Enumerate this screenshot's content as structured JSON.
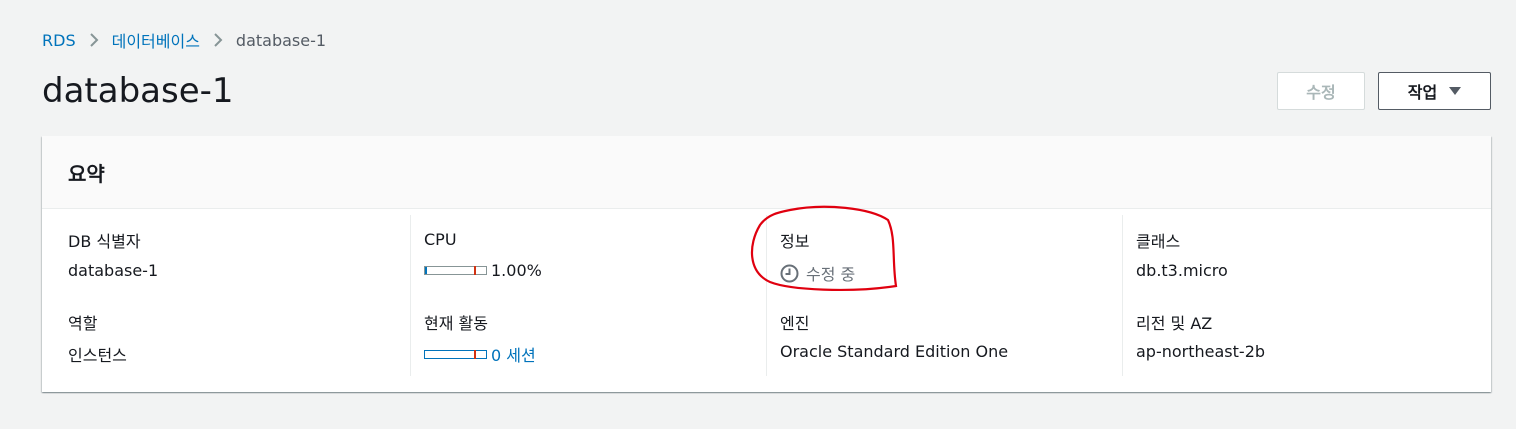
{
  "breadcrumb": {
    "items": [
      "RDS",
      "데이터베이스",
      "database-1"
    ]
  },
  "header": {
    "title": "database-1",
    "edit_label": "수정",
    "actions_label": "작업"
  },
  "summary": {
    "title": "요약",
    "db_identifier": {
      "label": "DB 식별자",
      "value": "database-1"
    },
    "role": {
      "label": "역할",
      "value": "인스턴스"
    },
    "cpu": {
      "label": "CPU",
      "value": "1.00%",
      "percent": 1.0
    },
    "current_activity": {
      "label": "현재 활동",
      "value": "0 세션",
      "sessions": 0
    },
    "status": {
      "label": "정보",
      "value": "수정 중"
    },
    "engine": {
      "label": "엔진",
      "value": "Oracle Standard Edition One"
    },
    "class": {
      "label": "클래스",
      "value": "db.t3.micro"
    },
    "region_az": {
      "label": "리전 및 AZ",
      "value": "ap-northeast-2b"
    }
  },
  "icons": {
    "breadcrumb_separator": "chevron-right-icon",
    "actions_caret": "caret-down-icon",
    "status": "clock-icon"
  },
  "colors": {
    "link": "#0073bb",
    "annotation": "#e0000f",
    "bar_marker": "#d13212",
    "status_pending": "#687078"
  }
}
